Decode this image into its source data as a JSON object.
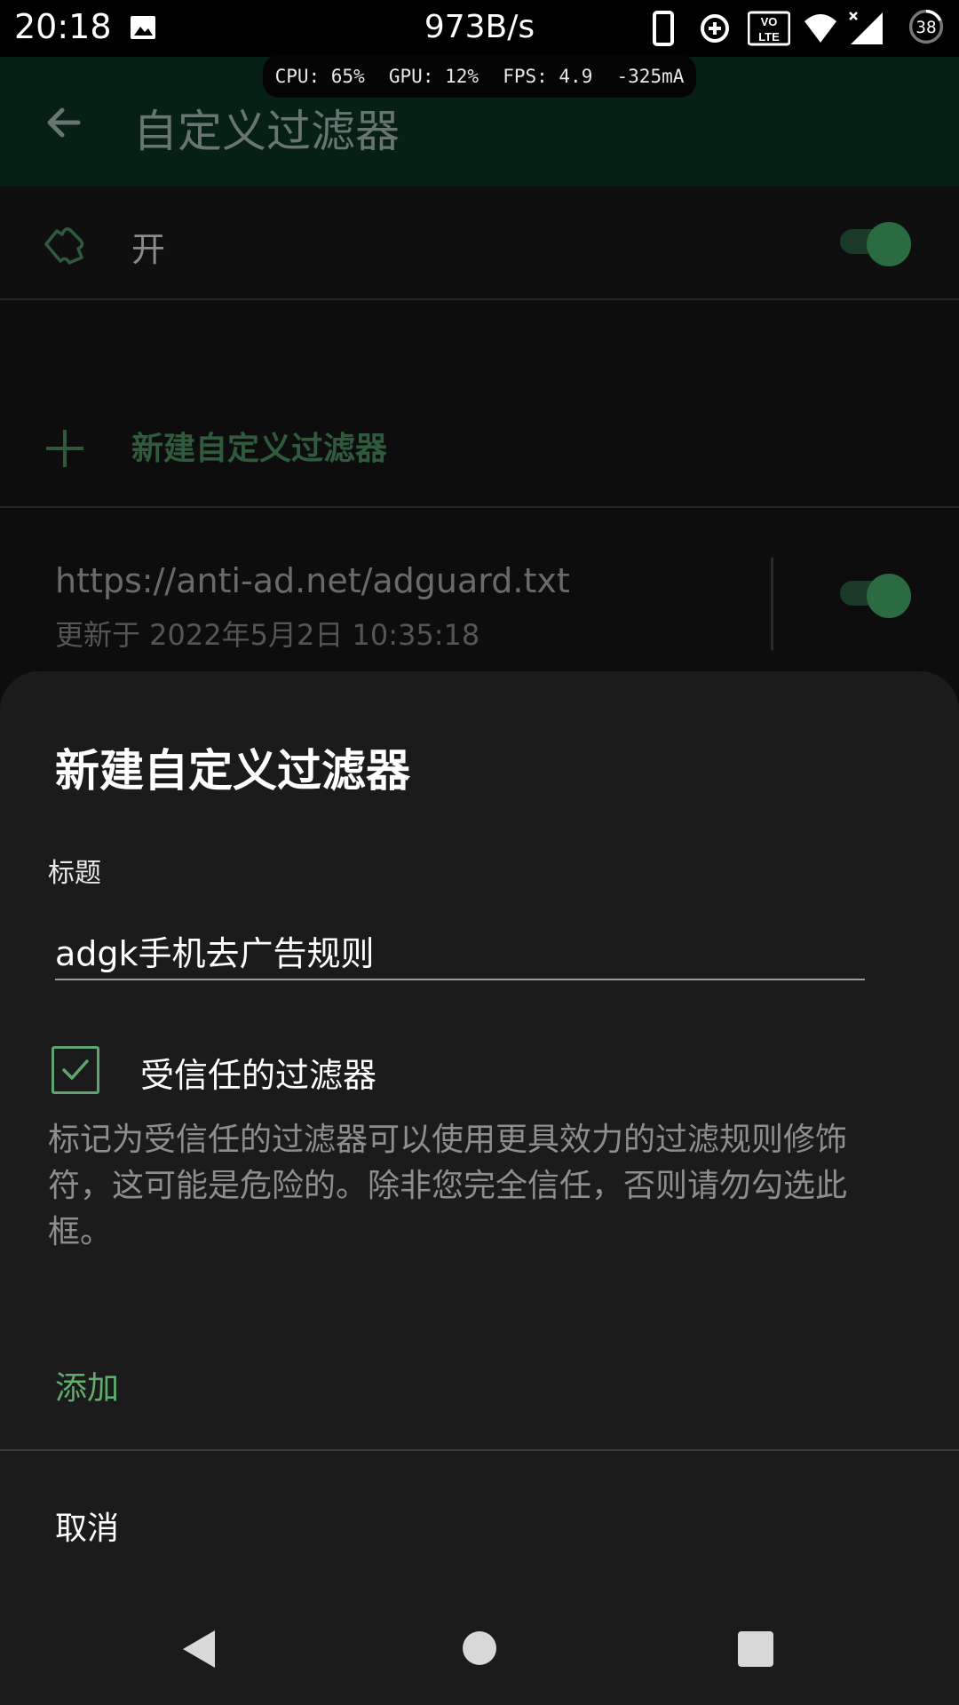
{
  "status_bar": {
    "time": "20:18",
    "network_speed": "973B/s",
    "battery": "38",
    "icons": [
      "image-icon",
      "phone-icon",
      "data-saver-icon",
      "volte-icon",
      "wifi-icon",
      "signal-icon",
      "battery-icon"
    ]
  },
  "perf_overlay": {
    "cpu": "CPU: 65%",
    "gpu": "GPU: 12%",
    "fps": "FPS: 4.9",
    "current": "-325mA"
  },
  "app_bar": {
    "title": "自定义过滤器"
  },
  "main_switch": {
    "label": "开",
    "on": true
  },
  "add_filter": {
    "label": "新建自定义过滤器"
  },
  "filters": [
    {
      "url": "https://anti-ad.net/adguard.txt",
      "updated": "更新于 2022年5月2日 10:35:18",
      "enabled": true
    }
  ],
  "dialog": {
    "title": "新建自定义过滤器",
    "field_label": "标题",
    "field_value": "adgk手机去广告规则",
    "trusted_label": "受信任的过滤器",
    "trusted_checked": true,
    "description": "标记为受信任的过滤器可以使用更具效力的过滤规则修饰符，这可能是危险的。除非您完全信任，否则请勿勾选此框。",
    "add_button": "添加",
    "cancel_button": "取消"
  },
  "colors": {
    "accent": "#5fae6e",
    "appbar": "#062016",
    "sheet": "#1b1b1b"
  }
}
